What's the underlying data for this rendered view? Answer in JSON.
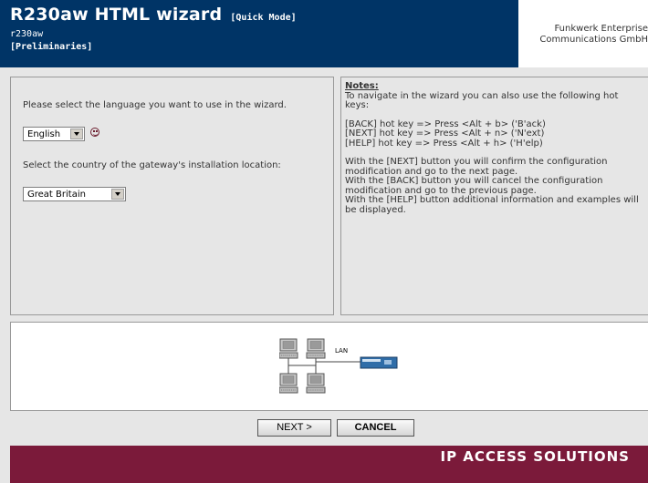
{
  "header": {
    "title": "R230aw HTML wizard",
    "mode": "[Quick Mode]",
    "device": "r230aw",
    "step": "[Preliminaries]",
    "company_line1": "Funkwerk Enterprise",
    "company_line2": "Communications GmbH"
  },
  "language": {
    "prompt": "Please select the language you want to use in the wizard.",
    "selected": "English"
  },
  "country": {
    "prompt": "Select the country of the gateway's installation location:",
    "selected": "Great Britain"
  },
  "notes": {
    "heading": "Notes:",
    "intro_1": "To navigate in the wizard you can also use the following hot",
    "intro_2": "keys:",
    "hotkey_back": "[BACK] hot key => Press <Alt + b> ('B'ack)",
    "hotkey_next": "[NEXT] hot key => Press <Alt + n> ('N'ext)",
    "hotkey_help": "[HELP] hot key => Press <Alt + h> ('H'elp)",
    "next_1": "With the [NEXT] button you will confirm the configuration",
    "next_2": "modification and go to the next page.",
    "back_1": "With the [BACK] button you will cancel the configuration",
    "back_2": "modification and go to the previous page.",
    "help_1": "With the [HELP] button additional information and examples will",
    "help_2": "be displayed."
  },
  "diagram": {
    "lan_label": "LAN"
  },
  "buttons": {
    "next": "NEXT >",
    "cancel": "CANCEL"
  },
  "footer": {
    "brand": "IP ACCESS SOLUTIONS"
  },
  "colors": {
    "header_bg": "#003466",
    "footer_bg": "#7b1a3a",
    "panel_bg": "#e6e6e6"
  }
}
